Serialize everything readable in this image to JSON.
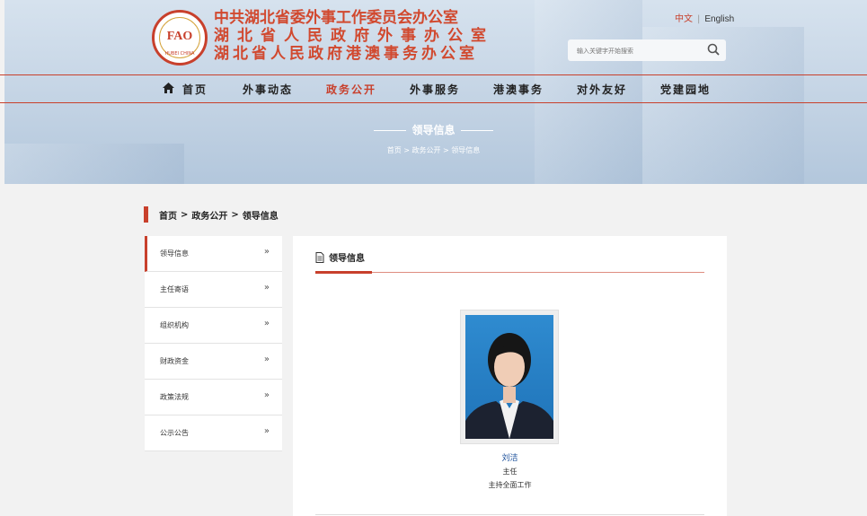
{
  "header": {
    "logo": {
      "fao": "FAO",
      "en": "HUBEI CHINA"
    },
    "orgs": [
      "中共湖北省委外事工作委员会办公室",
      "湖北省人民政府外事办公室",
      "湖北省人民政府港澳事务办公室"
    ],
    "lang": {
      "zh": "中文",
      "sep": "|",
      "en": "English"
    },
    "search": {
      "placeholder": "输入关键字开始搜索"
    }
  },
  "nav": {
    "items": [
      "首页",
      "外事动态",
      "政务公开",
      "外事服务",
      "港澳事务",
      "对外友好",
      "党建园地"
    ],
    "active": 2
  },
  "banner": {
    "title": "领导信息",
    "crumb": "首页 > 政务公开 > 领导信息"
  },
  "breadcrumb": {
    "items": [
      "首页",
      "政务公开",
      "领导信息"
    ],
    "sep": ">"
  },
  "sidebar": {
    "items": [
      "领导信息",
      "主任寄语",
      "组织机构",
      "财政资金",
      "政策法规",
      "公示公告"
    ],
    "arrow": "»"
  },
  "content": {
    "heading": "领导信息",
    "leader": {
      "name": "刘洁",
      "title": "主任",
      "duty": "主持全面工作"
    }
  },
  "colors": {
    "accent": "#c8402c",
    "name": "#1a4f9a"
  }
}
